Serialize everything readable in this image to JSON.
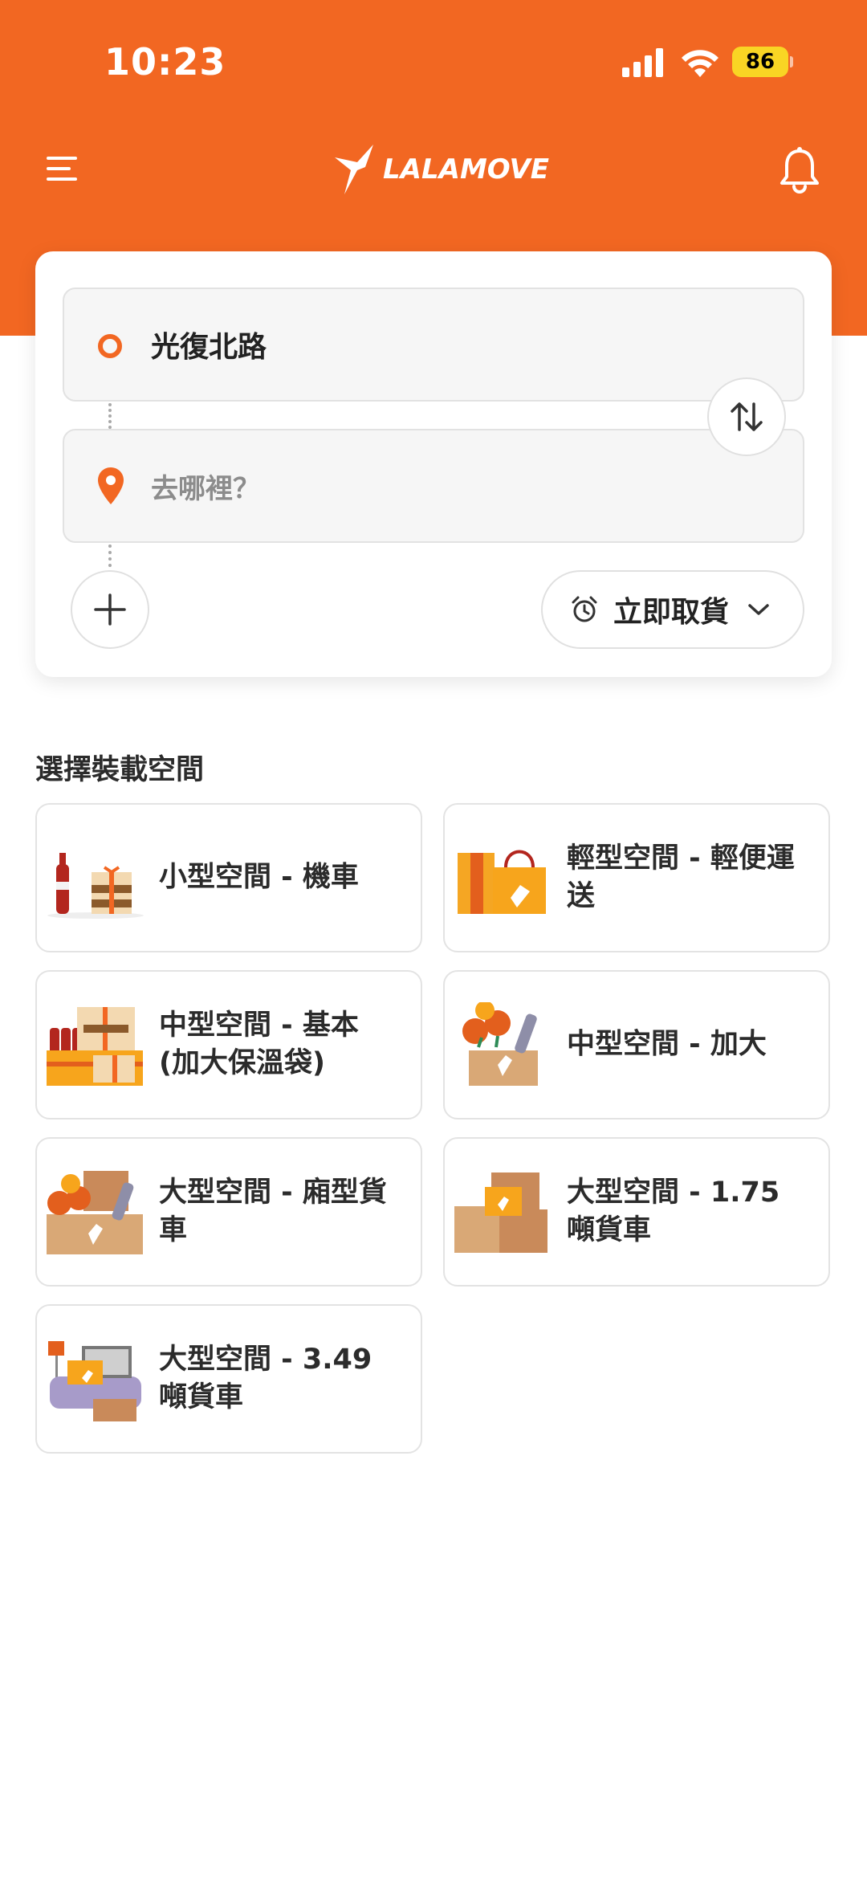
{
  "status_bar": {
    "time": "10:23",
    "battery": "86",
    "signal_icon": "signal-bars-icon",
    "wifi_icon": "wifi-icon"
  },
  "header": {
    "menu_icon": "hamburger-menu-icon",
    "logo_text": "LALAMOVE",
    "notification_icon": "bell-icon",
    "brand_color": "#F26722"
  },
  "route": {
    "pickup": {
      "value": "光復北路",
      "icon": "pickup-circle-icon"
    },
    "dropoff": {
      "placeholder": "去哪裡？",
      "icon": "location-pin-icon"
    },
    "swap_icon": "swap-arrows-icon",
    "add_stop_icon": "plus-icon",
    "pickup_time": {
      "label": "立即取貨",
      "icon": "alarm-clock-icon",
      "dropdown_icon": "chevron-down-icon"
    }
  },
  "vehicles": {
    "title": "選擇裝載空間",
    "items": [
      {
        "label": "小型空間 - 機車",
        "icon": "motorcycle-cargo-icon"
      },
      {
        "label": "輕型空間 - 輕便運送",
        "icon": "light-van-cargo-icon"
      },
      {
        "label": "中型空間 - 基本 (加大保溫袋)",
        "icon": "sedan-cargo-icon"
      },
      {
        "label": "中型空間 - 加大",
        "icon": "suv-cargo-icon"
      },
      {
        "label": "大型空間 - 廂型貨車",
        "icon": "van-cargo-icon"
      },
      {
        "label": "大型空間 - 1.75 噸貨車",
        "icon": "truck-175-cargo-icon"
      },
      {
        "label": "大型空間 - 3.49 噸貨車",
        "icon": "truck-349-cargo-icon"
      }
    ]
  }
}
